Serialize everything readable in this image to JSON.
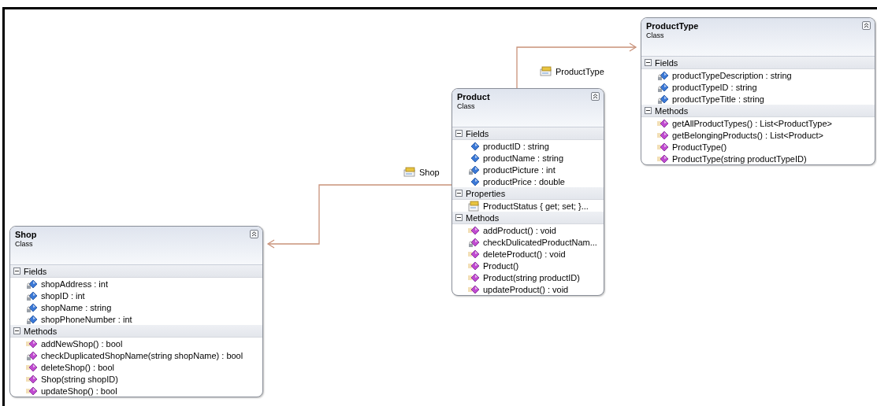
{
  "classes": [
    {
      "name": "Shop",
      "stereotype": "Class",
      "sections": [
        {
          "title": "Fields",
          "members": [
            {
              "kind": "private-field",
              "text": "shopAddress : int"
            },
            {
              "kind": "private-field",
              "text": "shopID : int"
            },
            {
              "kind": "private-field",
              "text": "shopName : string"
            },
            {
              "kind": "private-field",
              "text": "shopPhoneNumber : int"
            }
          ]
        },
        {
          "title": "Methods",
          "members": [
            {
              "kind": "method",
              "text": "addNewShop() : bool"
            },
            {
              "kind": "private-method",
              "text": "checkDuplicatedShopName(string shopName) : bool"
            },
            {
              "kind": "method",
              "text": "deleteShop() : bool"
            },
            {
              "kind": "method",
              "text": "Shop(string shopID)"
            },
            {
              "kind": "method",
              "text": "updateShop() : bool"
            }
          ]
        }
      ]
    },
    {
      "name": "Product",
      "stereotype": "Class",
      "sections": [
        {
          "title": "Fields",
          "members": [
            {
              "kind": "field",
              "text": "productID : string"
            },
            {
              "kind": "field",
              "text": "productName : string"
            },
            {
              "kind": "private-field",
              "text": "productPicture : int"
            },
            {
              "kind": "field",
              "text": "productPrice : double"
            }
          ]
        },
        {
          "title": "Properties",
          "members": [
            {
              "kind": "property",
              "text": "ProductStatus { get; set; }..."
            }
          ]
        },
        {
          "title": "Methods",
          "members": [
            {
              "kind": "method",
              "text": "addProduct() : void"
            },
            {
              "kind": "private-method",
              "text": "checkDulicatedProductNam..."
            },
            {
              "kind": "method",
              "text": "deleteProduct() : void"
            },
            {
              "kind": "method",
              "text": "Product()"
            },
            {
              "kind": "method",
              "text": "Product(string productID)"
            },
            {
              "kind": "method",
              "text": "updateProduct() : void"
            }
          ]
        }
      ]
    },
    {
      "name": "ProductType",
      "stereotype": "Class",
      "sections": [
        {
          "title": "Fields",
          "members": [
            {
              "kind": "private-field",
              "text": "productTypeDescription : string"
            },
            {
              "kind": "private-field",
              "text": "productTypeID : string"
            },
            {
              "kind": "private-field",
              "text": "productTypeTitle : string"
            }
          ]
        },
        {
          "title": "Methods",
          "members": [
            {
              "kind": "method",
              "text": "getAllProductTypes() : List<ProductType>"
            },
            {
              "kind": "method",
              "text": "getBelongingProducts() : List<Product>"
            },
            {
              "kind": "method",
              "text": "ProductType()"
            },
            {
              "kind": "method",
              "text": "ProductType(string productTypeID)"
            }
          ]
        }
      ]
    }
  ],
  "associations": [
    {
      "label": "Shop"
    },
    {
      "label": "ProductType"
    }
  ]
}
